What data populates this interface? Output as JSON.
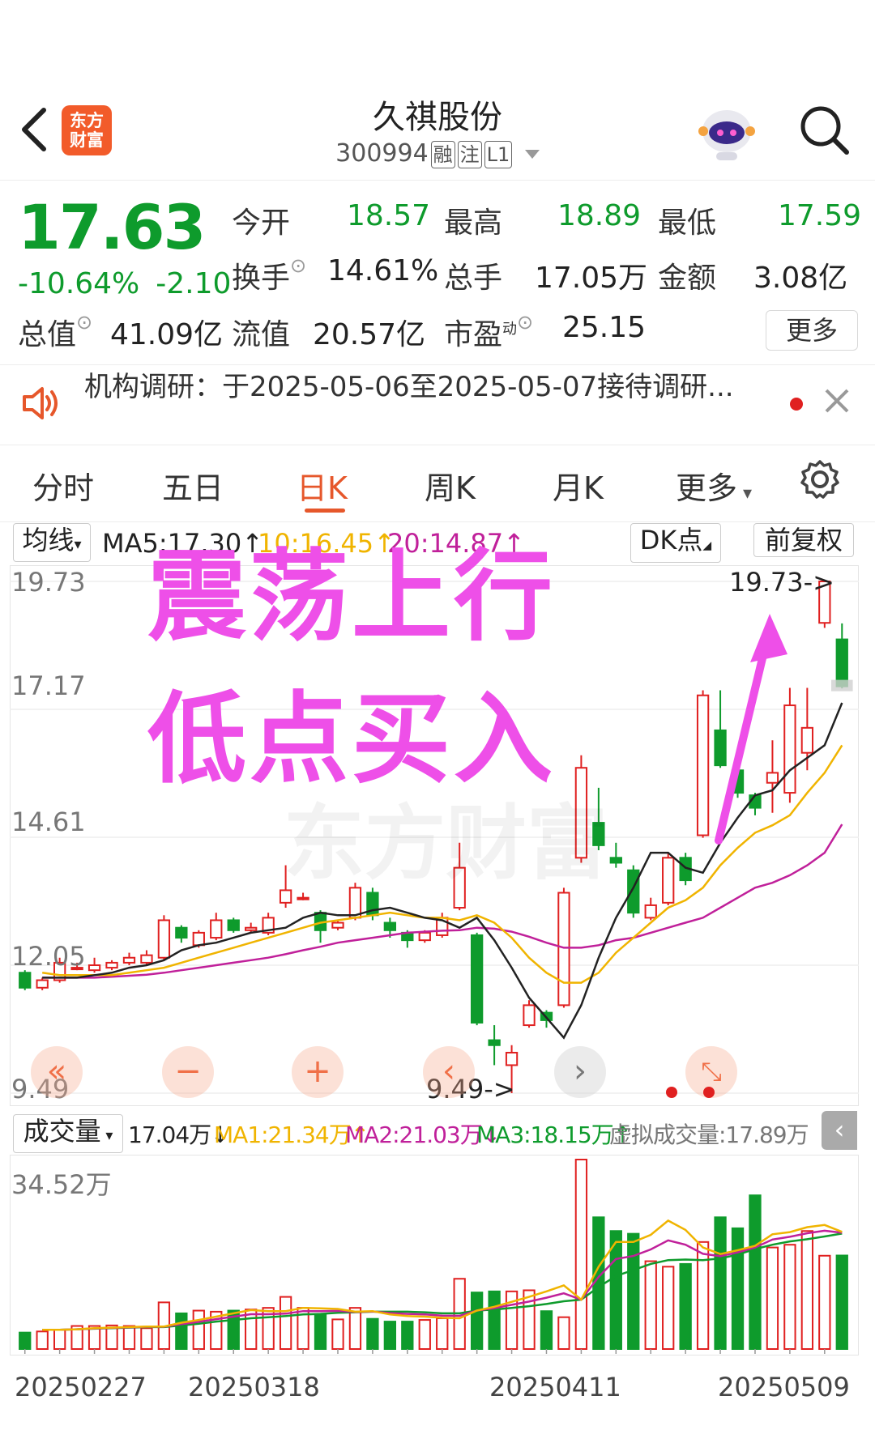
{
  "header": {
    "logo_text": "东方财富",
    "stock_name": "久祺股份",
    "stock_code": "300994",
    "tags": [
      "融",
      "注",
      "L1"
    ]
  },
  "quote": {
    "price": "17.63",
    "change_pct": "-10.64%",
    "change": "-2.10",
    "open_label": "今开",
    "open": "18.57",
    "high_label": "最高",
    "high": "18.89",
    "low_label": "最低",
    "low": "17.59",
    "turnover_label": "换手",
    "turnover": "14.61%",
    "volume_label": "总手",
    "volume": "17.05万",
    "amount_label": "金额",
    "amount": "3.08亿",
    "mktcap_label": "总值",
    "mktcap": "41.09亿",
    "float_label": "流值",
    "float": "20.57亿",
    "pe_label": "市盈",
    "pe_sup": "动",
    "pe": "25.15",
    "more_label": "更多"
  },
  "notice": {
    "text": "机构调研：于2025-05-06至2025-05-07接待调研..."
  },
  "tabs": [
    "分时",
    "五日",
    "日K",
    "周K",
    "月K",
    "更多"
  ],
  "active_tab": "日K",
  "indicators": {
    "ma_select": "均线",
    "ma5": "MA5:17.30",
    "ma10": "10:16.45",
    "ma20": "20:14.87",
    "dk": "DK点",
    "adjust": "前复权"
  },
  "overlay": {
    "line1": "震荡上行",
    "line2": "低点买入"
  },
  "watermark": "东方财富",
  "volume_panel": {
    "select": "成交量",
    "vol": "17.04万",
    "ma1": "MA1:21.34万",
    "ma2": "MA2:21.03万",
    "ma3": "MA3:18.15万",
    "virtual": "虚拟成交量:17.89万",
    "ymax_label": "34.52万"
  },
  "colors": {
    "up": "#e02020",
    "down": "#0e9b2c",
    "ma5": "#222222",
    "ma10": "#f0b400",
    "ma20": "#c0209a",
    "accent": "#e6572b",
    "overlay": "#ee4fe8"
  },
  "chart_data": {
    "type": "candlestick",
    "y_ticks": [
      "19.73",
      "17.17",
      "14.61",
      "12.05",
      "9.49"
    ],
    "ylim": [
      9.49,
      19.73
    ],
    "max_marker": "19.73->",
    "min_marker": "9.49->",
    "x_ticks": [
      "20250227",
      "20250318",
      "20250411",
      "20250509"
    ],
    "candles": [
      {
        "o": 11.9,
        "c": 11.6,
        "h": 11.95,
        "l": 11.55
      },
      {
        "o": 11.6,
        "c": 11.75,
        "h": 11.8,
        "l": 11.55
      },
      {
        "o": 11.75,
        "c": 12.1,
        "h": 12.2,
        "l": 11.7
      },
      {
        "o": 12.0,
        "c": 12.0,
        "h": 12.1,
        "l": 11.95
      },
      {
        "o": 11.95,
        "c": 12.05,
        "h": 12.2,
        "l": 11.9
      },
      {
        "o": 12.0,
        "c": 12.1,
        "h": 12.15,
        "l": 11.95
      },
      {
        "o": 12.1,
        "c": 12.2,
        "h": 12.3,
        "l": 12.05
      },
      {
        "o": 12.1,
        "c": 12.25,
        "h": 12.35,
        "l": 12.05
      },
      {
        "o": 12.2,
        "c": 12.95,
        "h": 13.05,
        "l": 12.15
      },
      {
        "o": 12.8,
        "c": 12.6,
        "h": 12.85,
        "l": 12.5
      },
      {
        "o": 12.45,
        "c": 12.7,
        "h": 12.75,
        "l": 12.4
      },
      {
        "o": 12.6,
        "c": 12.95,
        "h": 13.1,
        "l": 12.55
      },
      {
        "o": 12.95,
        "c": 12.75,
        "h": 13.0,
        "l": 12.7
      },
      {
        "o": 12.75,
        "c": 12.8,
        "h": 12.9,
        "l": 12.7
      },
      {
        "o": 12.7,
        "c": 13.0,
        "h": 13.1,
        "l": 12.65
      },
      {
        "o": 13.3,
        "c": 13.55,
        "h": 14.05,
        "l": 13.2
      },
      {
        "o": 13.4,
        "c": 13.4,
        "h": 13.5,
        "l": 13.35
      },
      {
        "o": 13.1,
        "c": 12.75,
        "h": 13.15,
        "l": 12.5
      },
      {
        "o": 12.8,
        "c": 12.9,
        "h": 12.95,
        "l": 12.75
      },
      {
        "o": 13.0,
        "c": 13.6,
        "h": 13.7,
        "l": 12.95
      },
      {
        "o": 13.5,
        "c": 13.05,
        "h": 13.6,
        "l": 12.95
      },
      {
        "o": 12.9,
        "c": 12.75,
        "h": 13.0,
        "l": 12.6
      },
      {
        "o": 12.7,
        "c": 12.55,
        "h": 12.75,
        "l": 12.4
      },
      {
        "o": 12.55,
        "c": 12.7,
        "h": 12.75,
        "l": 12.5
      },
      {
        "o": 12.65,
        "c": 13.0,
        "h": 13.1,
        "l": 12.6
      },
      {
        "o": 13.2,
        "c": 14.0,
        "h": 14.5,
        "l": 13.15
      },
      {
        "o": 12.65,
        "c": 10.9,
        "h": 12.7,
        "l": 10.85
      },
      {
        "o": 10.55,
        "c": 10.45,
        "h": 10.85,
        "l": 10.05
      },
      {
        "o": 10.05,
        "c": 10.3,
        "h": 10.45,
        "l": 9.49
      },
      {
        "o": 10.85,
        "c": 11.25,
        "h": 11.35,
        "l": 10.8
      },
      {
        "o": 11.1,
        "c": 10.95,
        "h": 11.15,
        "l": 10.8
      },
      {
        "o": 11.25,
        "c": 13.5,
        "h": 13.6,
        "l": 11.2
      },
      {
        "o": 14.2,
        "c": 16.0,
        "h": 16.25,
        "l": 14.1
      },
      {
        "o": 14.9,
        "c": 14.45,
        "h": 15.6,
        "l": 14.35
      },
      {
        "o": 14.2,
        "c": 14.1,
        "h": 14.5,
        "l": 14.0
      },
      {
        "o": 13.95,
        "c": 13.1,
        "h": 14.05,
        "l": 13.0
      },
      {
        "o": 13.0,
        "c": 13.25,
        "h": 13.4,
        "l": 12.95
      },
      {
        "o": 13.3,
        "c": 14.2,
        "h": 14.3,
        "l": 13.25
      },
      {
        "o": 14.2,
        "c": 13.75,
        "h": 14.3,
        "l": 13.65
      },
      {
        "o": 14.65,
        "c": 17.45,
        "h": 17.55,
        "l": 14.6
      },
      {
        "o": 16.75,
        "c": 16.05,
        "h": 17.55,
        "l": 16.0
      },
      {
        "o": 15.95,
        "c": 15.5,
        "h": 16.15,
        "l": 15.4
      },
      {
        "o": 15.45,
        "c": 15.2,
        "h": 15.5,
        "l": 15.05
      },
      {
        "o": 15.7,
        "c": 15.9,
        "h": 16.55,
        "l": 15.1
      },
      {
        "o": 15.5,
        "c": 17.25,
        "h": 17.6,
        "l": 15.3
      },
      {
        "o": 16.3,
        "c": 16.8,
        "h": 17.6,
        "l": 15.95
      },
      {
        "o": 18.9,
        "c": 19.73,
        "h": 19.73,
        "l": 18.8
      },
      {
        "o": 18.57,
        "c": 17.63,
        "h": 18.89,
        "l": 17.59
      }
    ],
    "ma5": [
      11.8,
      11.8,
      11.8,
      11.85,
      11.9,
      12.0,
      12.05,
      12.15,
      12.35,
      12.45,
      12.5,
      12.6,
      12.7,
      12.75,
      12.8,
      13.0,
      13.1,
      13.05,
      13.05,
      13.15,
      13.2,
      13.1,
      13.0,
      12.95,
      12.8,
      13.0,
      12.55,
      12.0,
      11.4,
      11.0,
      10.6,
      11.25,
      12.2,
      13.0,
      13.6,
      14.3,
      14.3,
      14.0,
      13.9,
      14.5,
      15.0,
      15.45,
      15.55,
      15.95,
      16.2,
      16.45,
      17.3
    ],
    "ma10": [
      11.9,
      11.85,
      11.85,
      11.85,
      11.85,
      11.9,
      11.95,
      12.0,
      12.1,
      12.2,
      12.3,
      12.4,
      12.5,
      12.6,
      12.7,
      12.8,
      12.9,
      12.95,
      13.0,
      13.05,
      13.1,
      13.05,
      13.0,
      13.0,
      12.95,
      13.05,
      12.9,
      12.6,
      12.2,
      11.9,
      11.7,
      11.7,
      11.9,
      12.3,
      12.6,
      12.9,
      13.2,
      13.35,
      13.6,
      14.05,
      14.4,
      14.7,
      14.85,
      15.05,
      15.5,
      15.9,
      16.45
    ],
    "ma20": [
      11.8,
      11.8,
      11.8,
      11.8,
      11.82,
      11.84,
      11.86,
      11.9,
      11.95,
      12.0,
      12.05,
      12.1,
      12.15,
      12.2,
      12.27,
      12.35,
      12.42,
      12.5,
      12.55,
      12.6,
      12.65,
      12.7,
      12.72,
      12.74,
      12.75,
      12.8,
      12.78,
      12.72,
      12.62,
      12.5,
      12.4,
      12.4,
      12.45,
      12.55,
      12.6,
      12.7,
      12.8,
      12.9,
      13.0,
      13.2,
      13.4,
      13.6,
      13.7,
      13.85,
      14.05,
      14.3,
      14.87
    ],
    "volumes": [
      3.0,
      3.2,
      3.5,
      4.2,
      4.2,
      4.3,
      4.2,
      3.8,
      8.5,
      6.5,
      7.0,
      6.8,
      7.0,
      7.2,
      7.5,
      9.5,
      7.5,
      6.2,
      5.4,
      7.5,
      5.5,
      5.0,
      5.0,
      5.3,
      5.6,
      12.8,
      10.3,
      10.5,
      10.5,
      10.7,
      6.9,
      5.8,
      34.52,
      24.0,
      21.5,
      21.0,
      16.0,
      15.0,
      15.5,
      19.5,
      24.0,
      22.0,
      28.0,
      18.5,
      19.0,
      21.5,
      17.0,
      17.04
    ],
    "vol_ma1": [
      3.5,
      3.5,
      3.6,
      3.8,
      3.9,
      4.0,
      4.1,
      4.1,
      4.8,
      5.3,
      5.9,
      6.5,
      7.1,
      6.9,
      6.9,
      7.5,
      7.4,
      7.3,
      6.8,
      6.9,
      6.3,
      6.0,
      5.9,
      5.7,
      5.6,
      7.0,
      7.7,
      8.6,
      9.5,
      10.5,
      11.6,
      9.0,
      15.0,
      19.5,
      19.5,
      20.8,
      23.4,
      21.7,
      18.5,
      17.3,
      18.0,
      18.8,
      20.9,
      21.3,
      22.2,
      22.6,
      21.34
    ],
    "vol_ma2": [
      3.5,
      3.5,
      3.6,
      3.7,
      3.8,
      3.9,
      4.0,
      4.0,
      4.3,
      4.6,
      5.0,
      5.3,
      5.6,
      5.8,
      6.0,
      6.3,
      6.4,
      6.6,
      6.7,
      6.8,
      6.8,
      6.8,
      6.7,
      6.5,
      6.5,
      7.0,
      7.2,
      7.5,
      7.8,
      8.2,
      8.7,
      9.0,
      11.3,
      13.3,
      14.4,
      15.5,
      16.2,
      16.3,
      16.2,
      16.5,
      17.2,
      18.2,
      19.0,
      19.6,
      20.0,
      20.5,
      21.03
    ]
  }
}
